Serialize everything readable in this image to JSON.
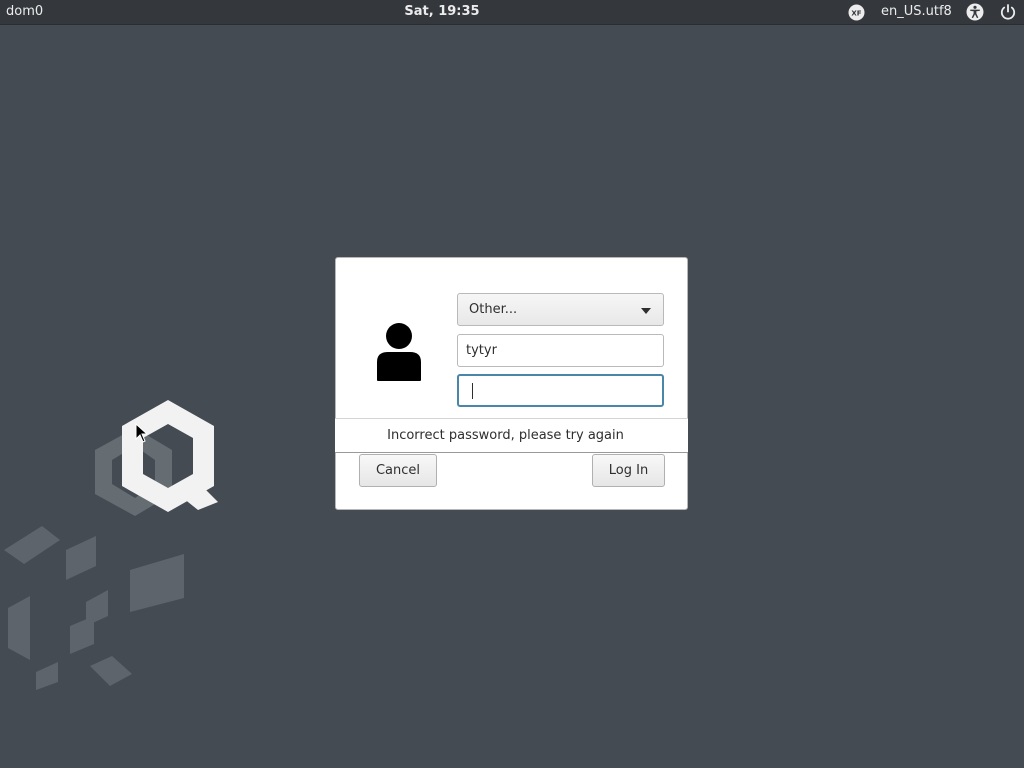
{
  "topbar": {
    "host": "dom0",
    "clock": "Sat, 19:35",
    "xf_badge": "XF",
    "locale": "en_US.utf8",
    "icons": [
      "xf-icon",
      "accessibility-icon",
      "power-icon"
    ]
  },
  "login": {
    "user_select": "Other...",
    "username": "tytyr",
    "password": "",
    "error": "Incorrect password, please try again",
    "cancel_label": "Cancel",
    "login_label": "Log In",
    "avatar_icon": "user-avatar-icon"
  },
  "colors": {
    "desktop": "#444b53",
    "topbar": "#34383d",
    "focus": "#4a86a8"
  }
}
